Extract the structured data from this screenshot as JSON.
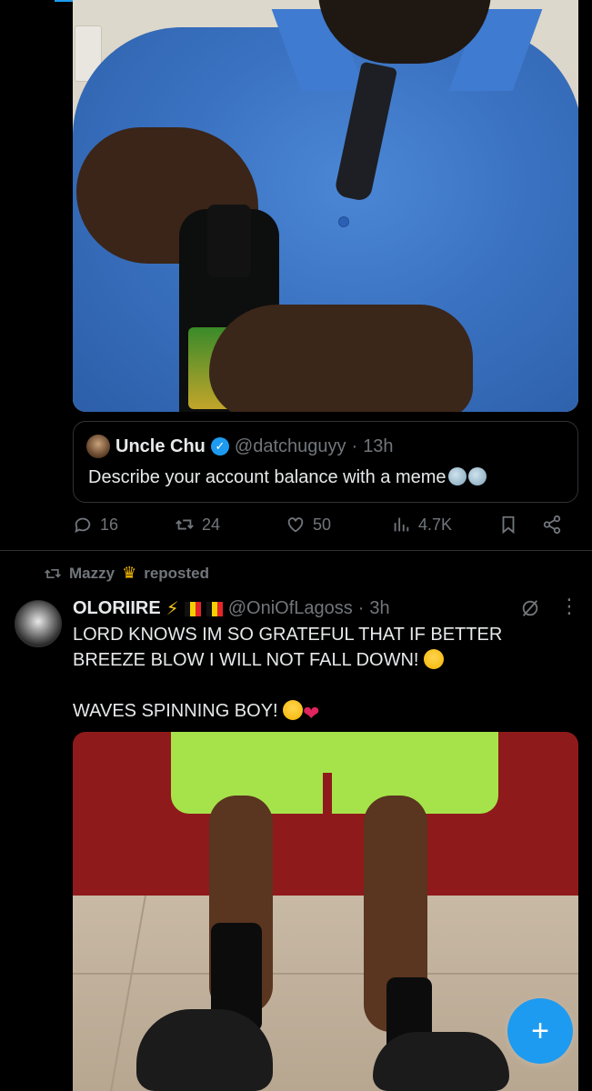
{
  "quoted_tweet": {
    "name": "Uncle Chu",
    "handle": "@datchuguyy",
    "time": "13h",
    "text": "Describe your account balance with a meme"
  },
  "actions": {
    "replies": "16",
    "reposts": "24",
    "likes": "50",
    "views": "4.7K"
  },
  "repost_banner": {
    "user": "Mazzy",
    "label": "reposted"
  },
  "post": {
    "name": "OLORIIRE",
    "handle": "@OniOfLagoss",
    "time": "3h",
    "text_line1": "LORD KNOWS IM SO GRATEFUL THAT IF BETTER BREEZE BLOW I WILL NOT FALL DOWN!",
    "text_line2": "WAVES SPINNING BOY!"
  },
  "icons": {
    "reply": "reply-icon",
    "repost": "repost-icon",
    "like": "heart-icon",
    "views": "views-icon",
    "bookmark": "bookmark-icon",
    "share": "share-icon",
    "grok": "grok-icon",
    "more": "more-icon",
    "compose": "compose-icon"
  },
  "colors": {
    "accent": "#1d9bf0",
    "muted": "#71767b",
    "background": "#000000"
  }
}
